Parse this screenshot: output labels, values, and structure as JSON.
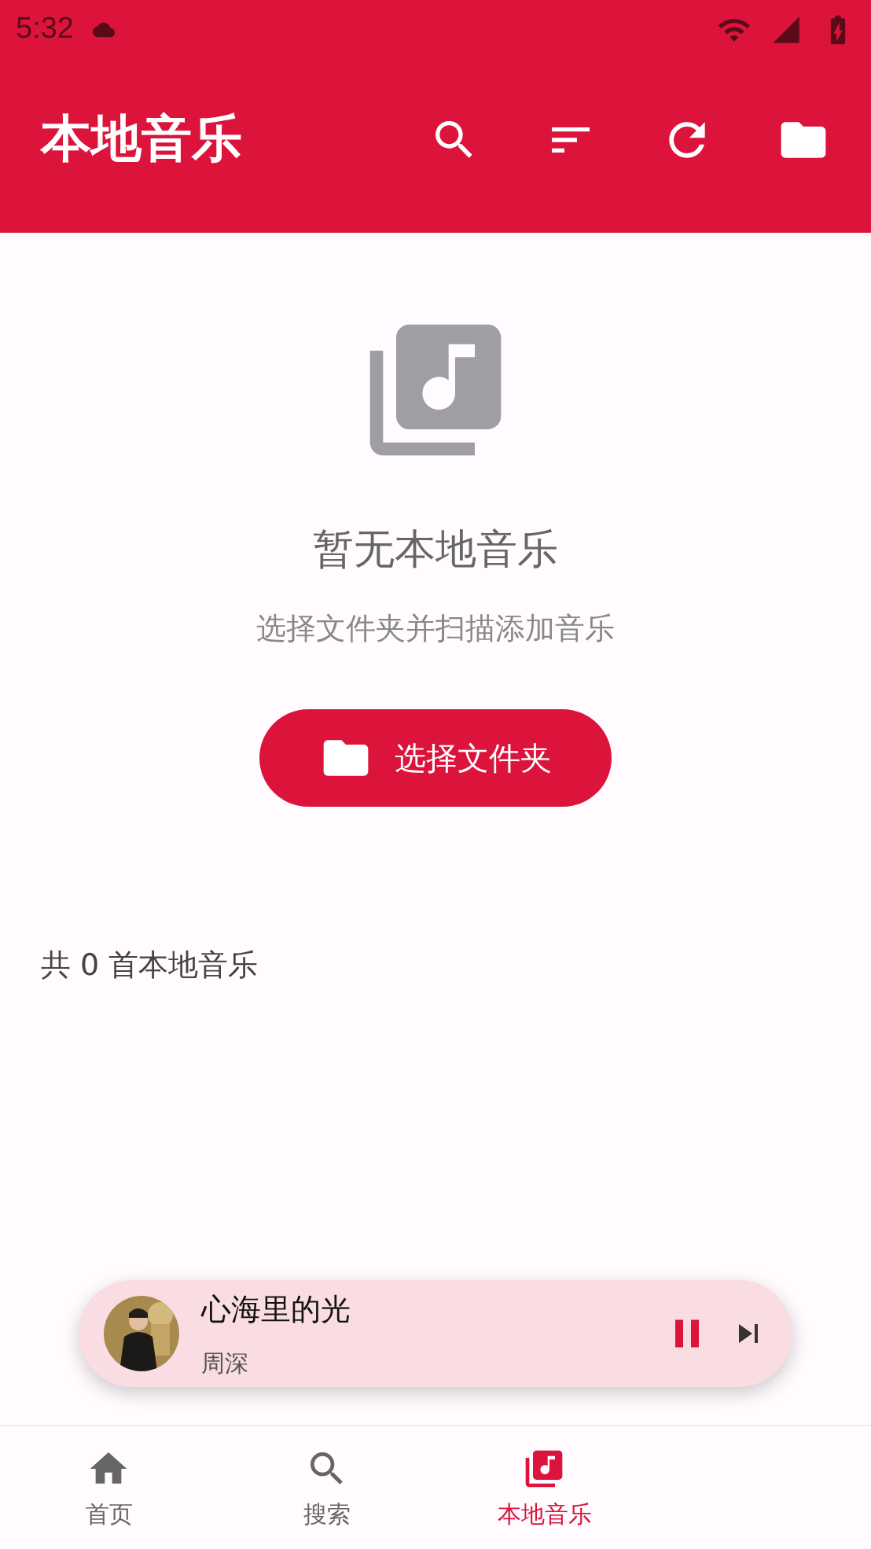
{
  "status_bar": {
    "time": "5:32"
  },
  "app_bar": {
    "title": "本地音乐"
  },
  "empty_state": {
    "title": "暂无本地音乐",
    "subtitle": "选择文件夹并扫描添加音乐",
    "button": "选择文件夹"
  },
  "summary": "共 0 首本地音乐",
  "mini_player": {
    "title": "心海里的光",
    "artist": "周深",
    "playing": true
  },
  "bottom_nav": [
    {
      "label": "首页",
      "kind": "home",
      "selected": false
    },
    {
      "label": "搜索",
      "kind": "search",
      "selected": false
    },
    {
      "label": "本地音乐",
      "kind": "library",
      "selected": true
    }
  ]
}
